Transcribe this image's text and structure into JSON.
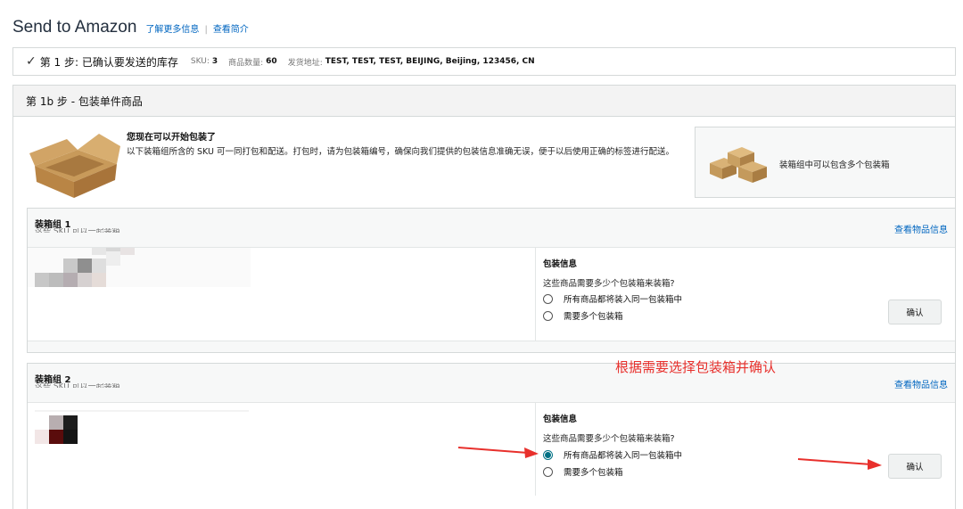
{
  "header": {
    "title": "Send to Amazon",
    "learn_more": "了解更多信息",
    "separator": "|",
    "view_intro": "查看简介"
  },
  "step1": {
    "label": "第 1 步:  已确认要发送的库存",
    "sku_label": "SKU:",
    "sku_value": "3",
    "qty_label": "商品数量:",
    "qty_value": "60",
    "ship_label": "发货地址:",
    "ship_value": "TEST, TEST, TEST, BEIJING, Beijing, 123456, CN"
  },
  "step1b": {
    "title": "第 1b 步 - 包装单件商品",
    "intro_title": "您现在可以开始包装了",
    "intro_text": "以下装箱组所含的 SKU 可一同打包和配送。打包时，请为包装箱编号，确保向我们提供的包装信息准确无误，便于以后使用正确的标签进行配送。",
    "promo_text": "装箱组中可以包含多个包装箱"
  },
  "groups": [
    {
      "name": "装箱组 1",
      "subtitle": "这些 SKU 可以一起装箱",
      "view_link": "查看物品信息",
      "pack_title": "包装信息",
      "pack_question": "这些商品需要多少个包装箱来装箱?",
      "options": [
        "所有商品都将装入同一包装箱中",
        "需要多个包装箱"
      ],
      "selected": null,
      "confirm": "确认"
    },
    {
      "name": "装箱组 2",
      "subtitle": "这些 SKU 可以一起装箱",
      "view_link": "查看物品信息",
      "pack_title": "包装信息",
      "pack_question": "这些商品需要多少个包装箱来装箱?",
      "options": [
        "所有商品都将装入同一包装箱中",
        "需要多个包装箱"
      ],
      "selected": 0,
      "confirm": "确认"
    }
  ],
  "annotation": "根据需要选择包装箱并确认",
  "colors": {
    "link": "#0066c0",
    "radio_selected": "#007185",
    "annotation": "#e8302c"
  }
}
